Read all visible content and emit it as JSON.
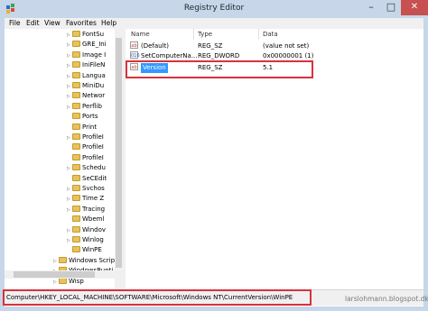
{
  "window": {
    "title": "Registry Editor"
  },
  "menu": [
    "File",
    "Edit",
    "View",
    "Favorites",
    "Help"
  ],
  "tree": {
    "items": [
      {
        "label": "FontSu",
        "expander": "▷",
        "indent": 1
      },
      {
        "label": "GRE_Ini",
        "expander": "▷",
        "indent": 1
      },
      {
        "label": "Image I",
        "expander": "▷",
        "indent": 1
      },
      {
        "label": "IniFileN",
        "expander": "▷",
        "indent": 1
      },
      {
        "label": "Langua",
        "expander": "▷",
        "indent": 1
      },
      {
        "label": "MiniDu",
        "expander": "▷",
        "indent": 1
      },
      {
        "label": "Networ",
        "expander": "▷",
        "indent": 1
      },
      {
        "label": "Perflib",
        "expander": "▷",
        "indent": 1
      },
      {
        "label": "Ports",
        "expander": "",
        "indent": 1
      },
      {
        "label": "Print",
        "expander": "",
        "indent": 1
      },
      {
        "label": "ProfileI",
        "expander": "▷",
        "indent": 1
      },
      {
        "label": "ProfileI",
        "expander": "",
        "indent": 1
      },
      {
        "label": "ProfileI",
        "expander": "",
        "indent": 1
      },
      {
        "label": "Schedu",
        "expander": "▷",
        "indent": 1
      },
      {
        "label": "SeCEdit",
        "expander": "",
        "indent": 1
      },
      {
        "label": "Svchos",
        "expander": "▷",
        "indent": 1
      },
      {
        "label": "Time Z",
        "expander": "▷",
        "indent": 1
      },
      {
        "label": "Tracing",
        "expander": "▷",
        "indent": 1
      },
      {
        "label": "Wbeml",
        "expander": "",
        "indent": 1
      },
      {
        "label": "Windov",
        "expander": "▷",
        "indent": 1
      },
      {
        "label": "Winlog",
        "expander": "▷",
        "indent": 1
      },
      {
        "label": "WinPE",
        "expander": "",
        "indent": 1
      },
      {
        "label": "Windows Scrip",
        "expander": "▷",
        "indent": 0
      },
      {
        "label": "WindowsRunti",
        "expander": "▷",
        "indent": 0
      },
      {
        "label": "Wisp",
        "expander": "▷",
        "indent": 0
      }
    ]
  },
  "columns": {
    "name": "Name",
    "type": "Type",
    "data": "Data"
  },
  "values": [
    {
      "icon": "ab",
      "icon_kind": "string-value-icon",
      "name": "(Default)",
      "type": "REG_SZ",
      "data": "(value not set)"
    },
    {
      "icon": "010",
      "icon_kind": "dword-value-icon",
      "name": "SetComputerNa...",
      "type": "REG_DWORD",
      "data": "0x00000001 (1)"
    },
    {
      "icon": "ab",
      "icon_kind": "string-value-icon",
      "name": "Version",
      "type": "REG_SZ",
      "data": "5.1"
    }
  ],
  "status": {
    "path": "Computer\\HKEY_LOCAL_MACHINE\\SOFTWARE\\Microsoft\\Windows NT\\CurrentVersion\\WinPE"
  },
  "watermark": "larslohmann.blogspot.dk",
  "colors": {
    "highlight": "#d8323c",
    "selection": "#3399ff",
    "titlebar": "#c7d6e8",
    "close": "#c75050"
  }
}
